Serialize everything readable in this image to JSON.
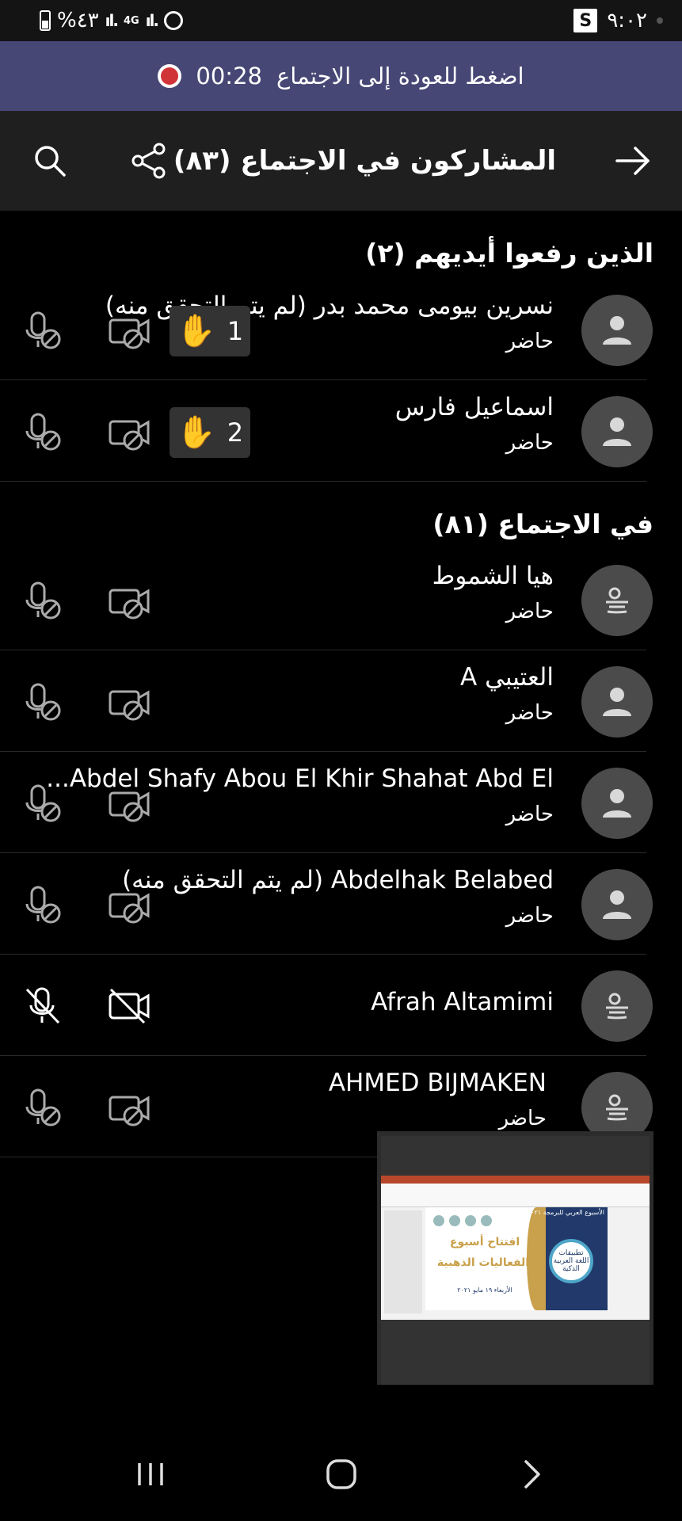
{
  "status_bar": {
    "battery_text": "%٤٣",
    "network": "4G",
    "time": "٩:٠٢",
    "app_indicator": "S"
  },
  "return_banner": {
    "timer": "00:28",
    "text": "اضغط للعودة إلى الاجتماع",
    "recording_color": "#d13438"
  },
  "header": {
    "title": "المشاركون في الاجتماع (٨٣)",
    "icons": [
      "back-arrow-icon",
      "share-icon",
      "search-icon"
    ]
  },
  "sections": {
    "raised_hands": {
      "title": "الذين رفعوا أيديهم (٢)",
      "participants": [
        {
          "name": "نسرين بيومى محمد بدر (لم يتم التحقق منه)",
          "status": "حاضر",
          "hand_order": "1"
        },
        {
          "name": "اسماعيل فارس",
          "status": "حاضر",
          "hand_order": "2"
        }
      ]
    },
    "in_meeting": {
      "title": "في الاجتماع (٨١)",
      "participants": [
        {
          "name": "هيا الشموط",
          "status": "حاضر"
        },
        {
          "name": "العتيبي A",
          "status": "حاضر"
        },
        {
          "name": "Abdel Shafy Abou El Khir Shahat Abd El...",
          "status": "حاضر"
        },
        {
          "name": "Abdelhak Belabed (لم يتم التحقق منه)",
          "status": "حاضر"
        },
        {
          "name": "Afrah Altamimi",
          "status": ""
        },
        {
          "name": "AHMED BIJMAKEN",
          "status": "حاضر"
        }
      ]
    }
  },
  "video_preview": {
    "slide_header": "الأسبوع العربي للبرمجة ٢٠٢١",
    "slide_line1": "افتتاح أسبوع",
    "slide_line2": "الفعاليات الذهبية",
    "slide_date": "الأربعاء ١٩ مايو ٢٠٢١",
    "slide_badge": "تطبيقات اللغة العربية الذكية"
  },
  "colors": {
    "banner": "#464775",
    "header": "#1f1f1f",
    "background": "#000000"
  }
}
